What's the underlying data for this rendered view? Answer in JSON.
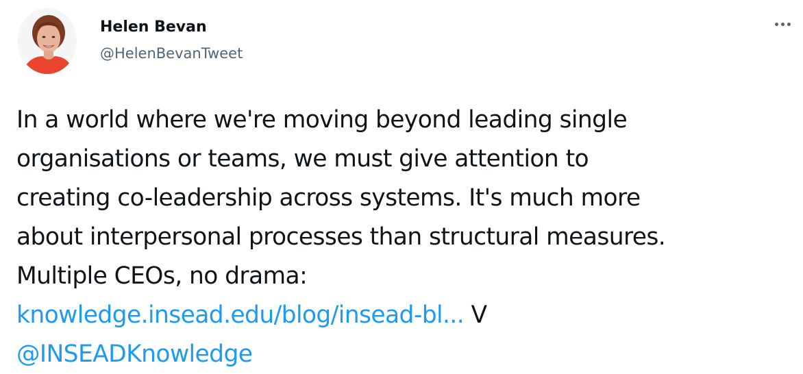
{
  "user": {
    "display_name": "Helen Bevan",
    "handle": "@HelenBevanTweet"
  },
  "icons": {
    "more": "more-horizontal-icon"
  },
  "colors": {
    "link": "#1d9bf0",
    "text": "#0f1419",
    "secondary": "#536471"
  },
  "tweet": {
    "lines": [
      "In a world where we're moving beyond leading single",
      "organisations or teams, we must give attention to",
      "creating co-leadership across systems. It's much more",
      "about interpersonal processes than structural measures.",
      "Multiple CEOs, no drama:"
    ],
    "link_text": "knowledge.insead.edu/blog/insead-bl...",
    "after_link": " V",
    "mention": "@INSEADKnowledge"
  }
}
